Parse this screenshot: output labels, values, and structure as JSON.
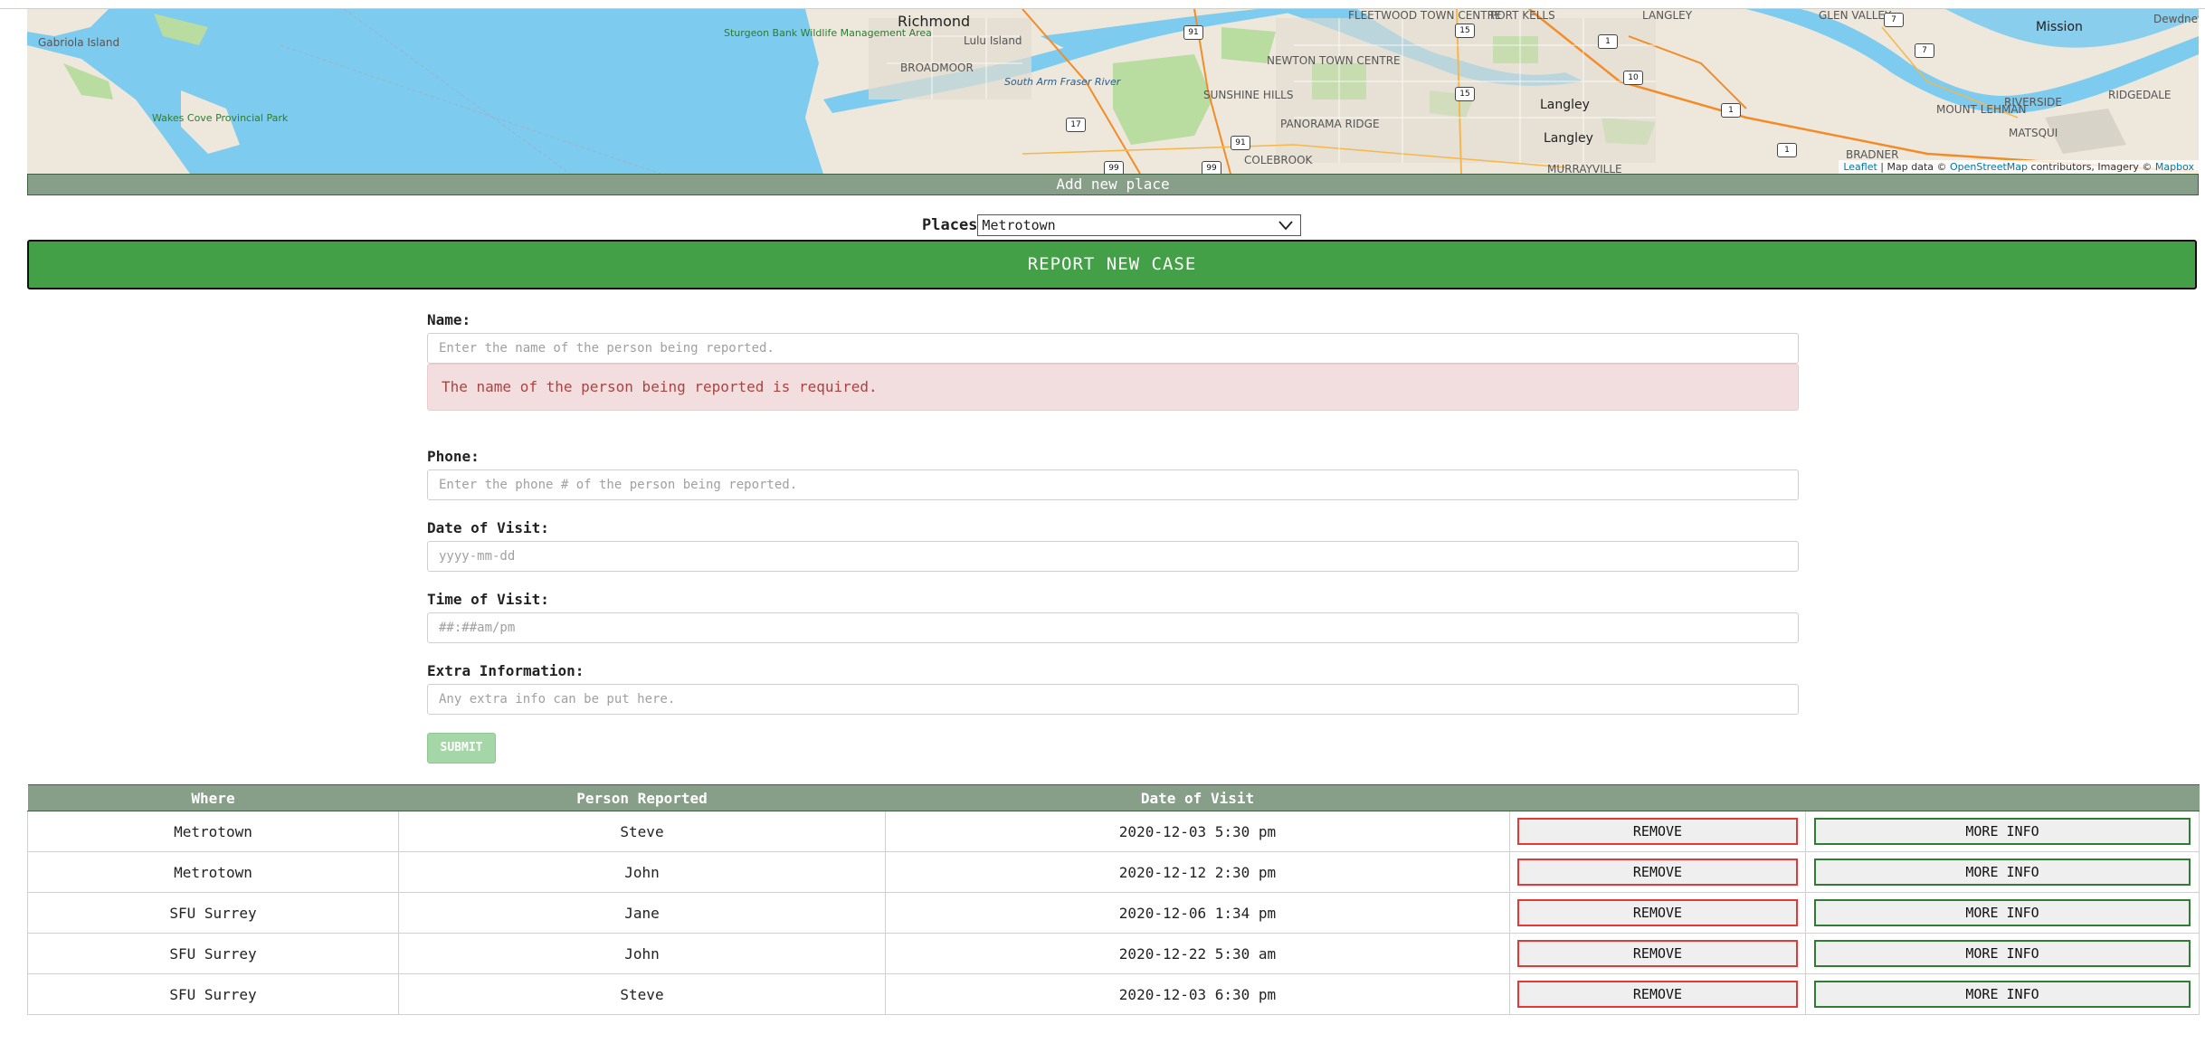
{
  "map": {
    "labels": {
      "gabriola": "Gabriola Island",
      "wakes_cove": "Wakes Cove Provincial Park",
      "sturgeon": "Sturgeon Bank Wildlife Management Area",
      "richmond": "Richmond",
      "lulu": "Lulu Island",
      "broadmoor": "BROADMOOR",
      "south_arm": "South Arm Fraser River",
      "fleetwood": "FLEETWOOD TOWN CENTRE",
      "port_kells": "PORT KELLS",
      "newton": "NEWTON TOWN CENTRE",
      "sunshine": "SUNSHINE HILLS",
      "panorama": "PANORAMA RIDGE",
      "colebrook": "COLEBROOK",
      "langley1": "Langley",
      "langley2": "Langley",
      "langley_top": "LANGLEY",
      "murrayville": "MURRAYVILLE",
      "glen_valley": "GLEN VALLEY",
      "mission": "Mission",
      "dewdney": "Dewdney",
      "riverside": "RIVERSIDE",
      "ridgedale": "RIDGEDALE",
      "mount_lehman": "MOUNT LEHMAN",
      "matsqui": "MATSQUI",
      "bradner": "BRADNER"
    },
    "shields": [
      "91",
      "15",
      "1",
      "10",
      "15",
      "17",
      "91",
      "99",
      "99",
      "1",
      "1",
      "7",
      "7"
    ],
    "attribution": {
      "leaflet": "Leaflet",
      "text1": " | Map data © ",
      "osm": "OpenStreetMap",
      "text2": " contributors, Imagery © ",
      "mapbox": "Mapbox"
    },
    "colors": {
      "water": "#7dcbee",
      "land": "#ede7dc",
      "park": "#b9dca0",
      "road": "#f28c28"
    }
  },
  "add_place_label": "Add new place",
  "places": {
    "label": "Places",
    "selected": "Metrotown"
  },
  "report_button": "REPORT NEW CASE",
  "form": {
    "name": {
      "label": "Name:",
      "placeholder": "Enter the name of the person being reported."
    },
    "name_error": "The name of the person being reported is required.",
    "phone": {
      "label": "Phone:",
      "placeholder": "Enter the phone # of the person being reported."
    },
    "date": {
      "label": "Date of Visit:",
      "placeholder": "yyyy-mm-dd"
    },
    "time": {
      "label": "Time of Visit:",
      "placeholder": "##:##am/pm"
    },
    "extra": {
      "label": "Extra Information:",
      "placeholder": "Any extra info can be put here."
    },
    "submit": "SUBMIT"
  },
  "table": {
    "headers": [
      "Where",
      "Person Reported",
      "Date of Visit",
      "",
      ""
    ],
    "remove_label": "REMOVE",
    "info_label": "MORE INFO",
    "rows": [
      {
        "where": "Metrotown",
        "person": "Steve",
        "date": "2020-12-03 5:30 pm"
      },
      {
        "where": "Metrotown",
        "person": "John",
        "date": "2020-12-12 2:30 pm"
      },
      {
        "where": "SFU Surrey",
        "person": "Jane",
        "date": "2020-12-06 1:34 pm"
      },
      {
        "where": "SFU Surrey",
        "person": "John",
        "date": "2020-12-22 5:30 am"
      },
      {
        "where": "SFU Surrey",
        "person": "Steve",
        "date": "2020-12-03 6:30 pm"
      }
    ]
  },
  "theme": {
    "header_green": "#879e88",
    "report_green": "#43a047",
    "remove_red": "#e53935",
    "info_green": "#2e7d32",
    "error_bg": "#f2dede",
    "error_text": "#a94442"
  }
}
